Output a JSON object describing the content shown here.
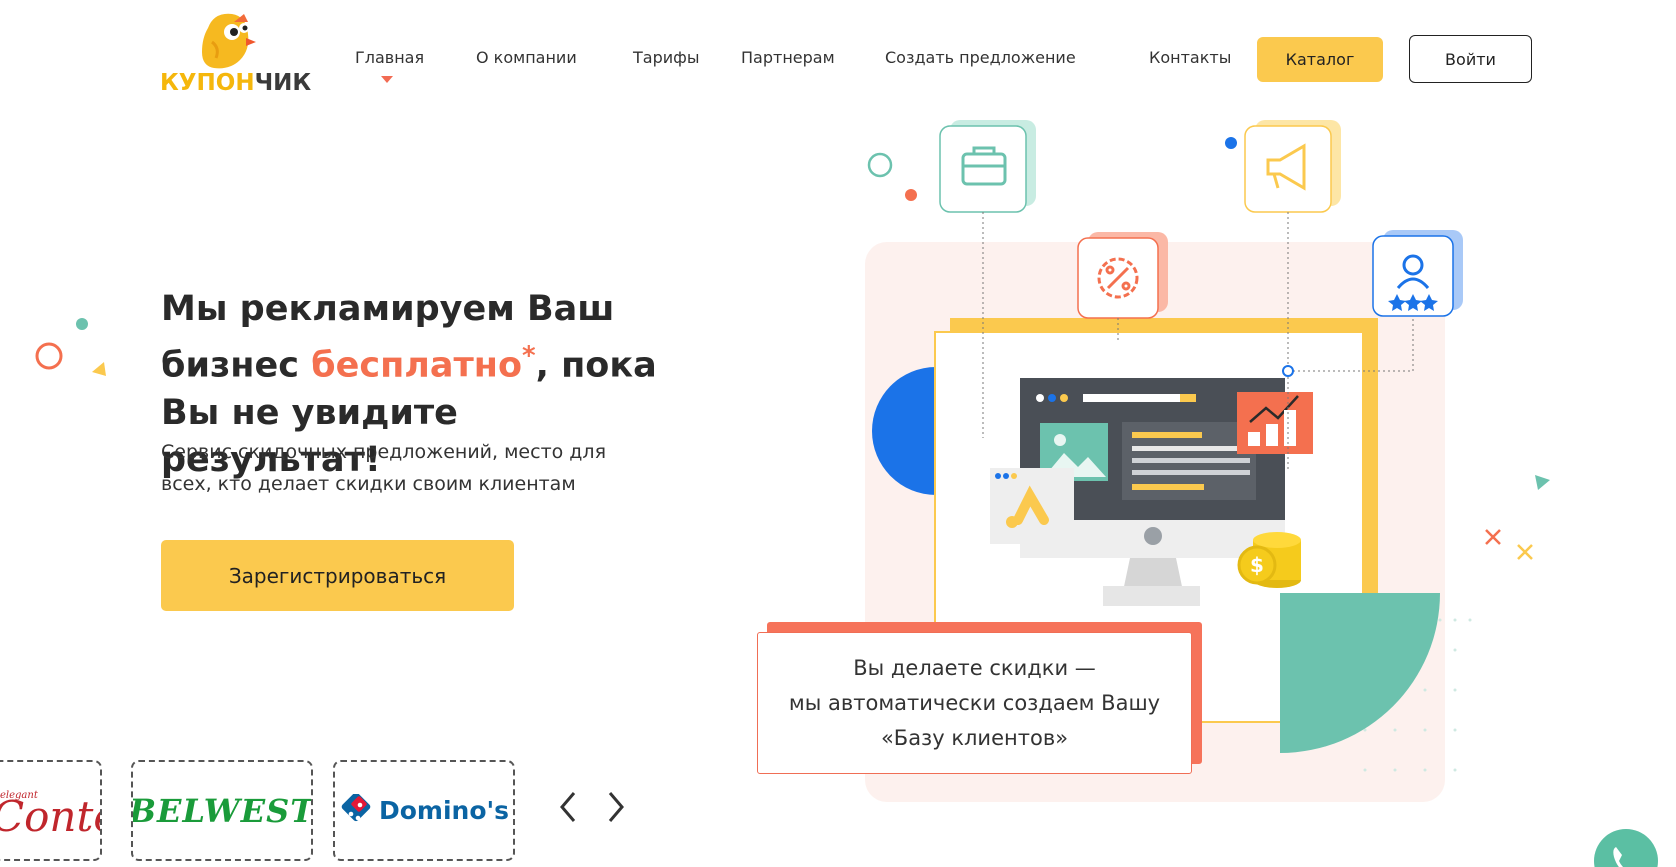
{
  "brand": {
    "logo_part1": "КУПОН",
    "logo_part2": "ЧИК",
    "logo_icon": "bird-mascot-icon"
  },
  "nav": {
    "items": [
      "Главная",
      "О компании",
      "Тарифы",
      "Партнерам",
      "Создать предложение",
      "Контакты"
    ],
    "active_index": 0,
    "catalog_label": "Каталог",
    "login_label": "Войти"
  },
  "hero": {
    "title_part1": "Мы рекламируем Ваш бизнес ",
    "title_accent": "бесплатно",
    "title_asterisk": "*",
    "title_part2": ", пока Вы не увидите результат!",
    "subtitle": "Сервис скидочных предложений, место для всех, кто делает скидки своим клиентам",
    "register_label": "Зарегистрироваться"
  },
  "partners": {
    "logos": [
      "Conte",
      "BELWEST",
      "Domino's"
    ],
    "conte_tag": "elegant",
    "prev_icon": "chevron-left-icon",
    "next_icon": "chevron-right-icon"
  },
  "illustration": {
    "callout_line1": "Вы делаете скидки —",
    "callout_line2": "мы автоматически создаем Вашу",
    "callout_line3": "«Базу клиентов»",
    "icons": [
      "briefcase-icon",
      "megaphone-icon",
      "percent-badge-icon",
      "user-rating-icon",
      "monitor-icon",
      "chart-icon",
      "coins-icon",
      "ads-icon"
    ]
  },
  "colors": {
    "accent_yellow": "#fbc94e",
    "accent_red": "#f4704f",
    "teal": "#6cc2ae",
    "blue": "#1b73e8"
  },
  "contact": {
    "phone_icon": "phone-icon"
  }
}
